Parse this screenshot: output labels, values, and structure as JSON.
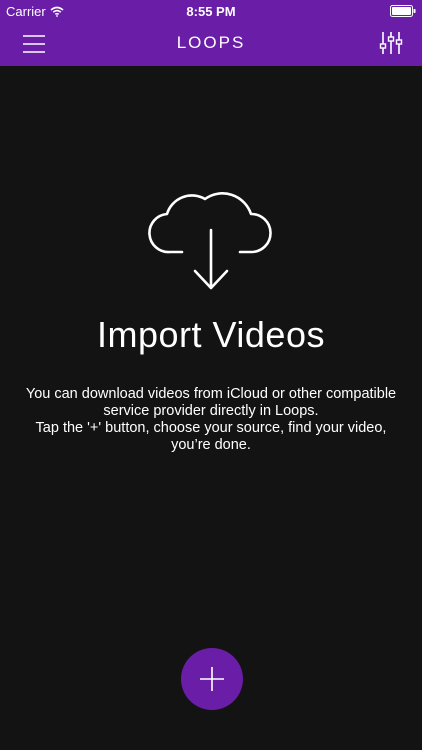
{
  "status_bar": {
    "carrier": "Carrier",
    "time": "8:55 PM"
  },
  "nav": {
    "title": "LOOPS",
    "menu_icon": "hamburger-menu-icon",
    "filter_icon": "sliders-icon"
  },
  "empty_state": {
    "icon": "cloud-download-icon",
    "title": "Import Videos",
    "lines": [
      "You can download videos from iCloud or other compatible",
      "service provider directly in Loops.",
      "Tap the '+' button, choose your source, find your video,",
      "you’re done."
    ]
  },
  "fab": {
    "icon": "plus-icon"
  },
  "colors": {
    "accent": "#6a1ea8",
    "background": "#141314",
    "text": "#ffffff"
  }
}
